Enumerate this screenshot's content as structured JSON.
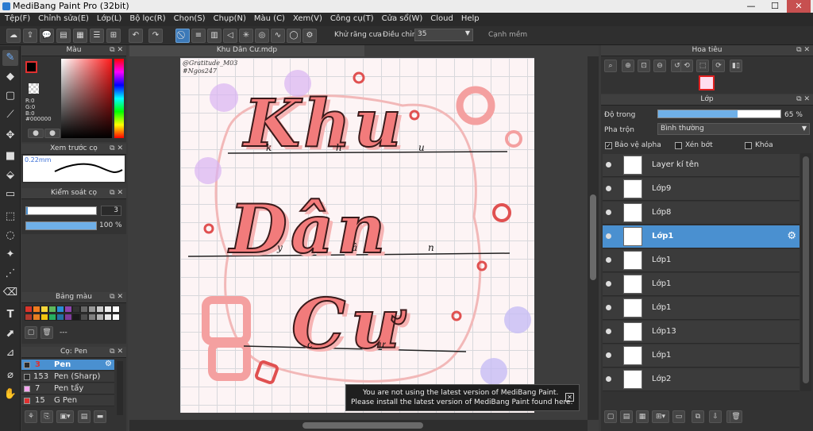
{
  "window": {
    "title": "MediBang Paint Pro (32bit)",
    "min": "—",
    "max": "☐",
    "close": "✕"
  },
  "menu": [
    "Tệp(F)",
    "Chỉnh sửa(E)",
    "Lớp(L)",
    "Bộ lọc(R)",
    "Chọn(S)",
    "Chụp(N)",
    "Màu (C)",
    "Xem(V)",
    "Công cụ(T)",
    "Cửa sổ(W)",
    "Cloud",
    "Help"
  ],
  "toolbar": {
    "antialias": "Khử răng cưa",
    "adjust": "Điều chỉnh",
    "adjust_value": "35",
    "sharp": "Cạnh mềm"
  },
  "color_panel": {
    "title": "Màu",
    "r": "R:0",
    "g": "G:0",
    "b": "B:0",
    "hex": "#000000",
    "fg": "#000000",
    "bg": "#ffffff"
  },
  "brush_preview": {
    "title": "Xem trước cọ",
    "size": "0.22mm"
  },
  "brush_control": {
    "title": "Kiểm soát cọ",
    "size": "3",
    "opacity": "100 %"
  },
  "palette": {
    "title": "Bảng màu",
    "colors": [
      "#d9342b",
      "#f07c1f",
      "#f5d53a",
      "#5cb85c",
      "#2a8fd6",
      "#8e44ad",
      "#333333",
      "#666666",
      "#999999",
      "#cccccc",
      "#eeeeee",
      "#ffffff",
      "#b03a2e",
      "#e67e22",
      "#f1c40f",
      "#27ae60",
      "#2471a3",
      "#7d3c98",
      "#1a1a1a",
      "#4d4d4d",
      "#808080",
      "#b3b3b3",
      "#e6e6e6",
      "#fafafa"
    ],
    "dash": "---"
  },
  "brushes": {
    "title": "Cọ: Pen",
    "items": [
      {
        "size": "3",
        "name": "Pen",
        "color": "#2a2a2a"
      },
      {
        "size": "153",
        "name": "Pen (Sharp)",
        "color": "#2a2a2a"
      },
      {
        "size": "7",
        "name": "Pen tẩy",
        "color": "#f6a6f0"
      },
      {
        "size": "15",
        "name": "G Pen",
        "color": "#e03030"
      }
    ]
  },
  "canvas": {
    "tab": "Khu Dân Cư.mdp",
    "signature": "@Gratitude_M03",
    "sig2": "#Ngos247",
    "word1": "Khu",
    "word2": "Dân",
    "word3": "Cư",
    "small1": [
      "k",
      "h",
      "u"
    ],
    "small2": [
      "y",
      "â",
      "n"
    ],
    "small3": [
      "c",
      "ư"
    ]
  },
  "notice": {
    "line1": "You are not using the latest version of MediBang Paint.",
    "line2": "Please install the latest version of MediBang Paint found here.",
    "close": "✕"
  },
  "navigator": {
    "title": "Hoa tiêu"
  },
  "layers": {
    "title": "Lớp",
    "opacity_label": "Độ trong",
    "opacity": "65 %",
    "opacity_value": 0.65,
    "blend_label": "Pha trộn",
    "blend": "Bình thường",
    "protect_alpha": "Bảo vệ alpha",
    "clip": "Xén bớt",
    "lock": "Khóa",
    "items": [
      "Layer kí tên",
      "Lớp9",
      "Lớp8",
      "Lớp1",
      "Lớp1",
      "Lớp1",
      "Lớp1",
      "Lớp13",
      "Lớp1",
      "Lớp2"
    ]
  }
}
